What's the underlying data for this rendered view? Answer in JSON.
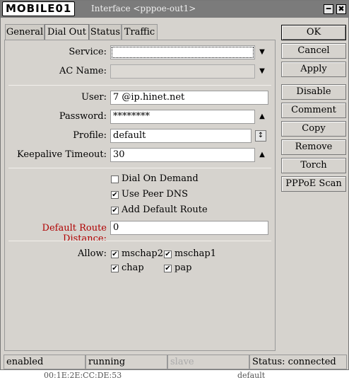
{
  "window": {
    "logo": "MOBILE01",
    "title": "Interface <pppoe-out1>",
    "minimize_glyph": "━",
    "close_glyph": "✖"
  },
  "tabs": [
    {
      "label": "General"
    },
    {
      "label": "Dial Out"
    },
    {
      "label": "Status"
    },
    {
      "label": "Traffic"
    }
  ],
  "form": {
    "service": {
      "label": "Service:",
      "value": ""
    },
    "ac_name": {
      "label": "AC Name:",
      "value": ""
    },
    "user": {
      "label": "User:",
      "value": "7          @ip.hinet.net"
    },
    "password": {
      "label": "Password:",
      "value": "********"
    },
    "profile": {
      "label": "Profile:",
      "value": "default"
    },
    "keepalive": {
      "label": "Keepalive Timeout:",
      "value": "30"
    },
    "dial_on_demand": {
      "label": "Dial On Demand",
      "checked": false
    },
    "use_peer_dns": {
      "label": "Use Peer DNS",
      "checked": true
    },
    "add_default_route": {
      "label": "Add Default Route",
      "checked": true
    },
    "default_route_distance": {
      "label": "Default Route Distance:",
      "value": "0",
      "label_color": "#b00000"
    },
    "allow": {
      "label": "Allow:",
      "options": [
        {
          "label": "mschap2",
          "checked": true
        },
        {
          "label": "mschap1",
          "checked": true
        },
        {
          "label": "chap",
          "checked": true
        },
        {
          "label": "pap",
          "checked": true
        }
      ]
    }
  },
  "glyphs": {
    "dropdown": "▼",
    "up": "▲",
    "check": "✔",
    "spin": "↕"
  },
  "buttons": [
    {
      "label": "OK"
    },
    {
      "label": "Cancel"
    },
    {
      "label": "Apply"
    },
    {
      "label": "Disable"
    },
    {
      "label": "Comment"
    },
    {
      "label": "Copy"
    },
    {
      "label": "Remove"
    },
    {
      "label": "Torch"
    },
    {
      "label": "PPPoE Scan"
    }
  ],
  "statusbar": {
    "state": "enabled",
    "run": "running",
    "slave": "slave",
    "status": "Status: connected"
  },
  "background_text": {
    "mac": "00:1E:2E:CC:DE:53",
    "other": "default"
  }
}
